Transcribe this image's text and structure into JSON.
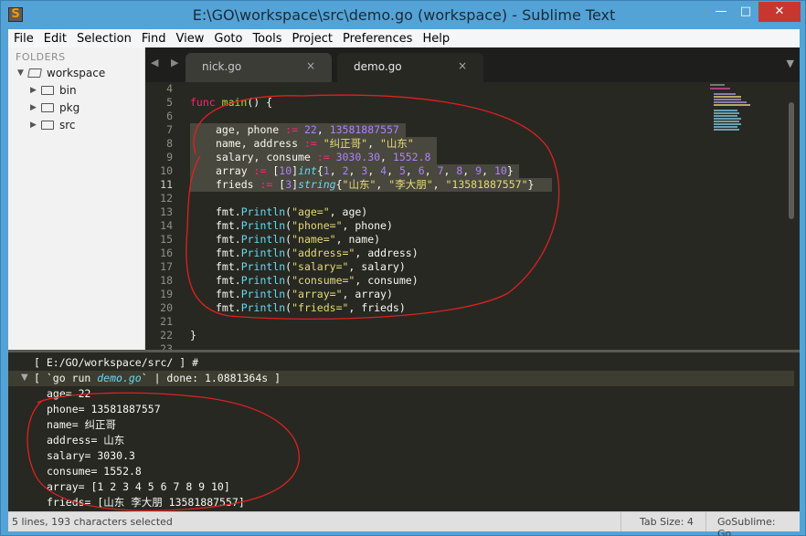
{
  "window": {
    "title": "E:\\GO\\workspace\\src\\demo.go (workspace) - Sublime Text",
    "controls": {
      "minimize": "—",
      "maximize": "□",
      "close": "✕"
    },
    "app_icon": "sublime-logo-icon"
  },
  "menu": [
    "File",
    "Edit",
    "Selection",
    "Find",
    "View",
    "Goto",
    "Tools",
    "Project",
    "Preferences",
    "Help"
  ],
  "sidebar": {
    "header": "FOLDERS",
    "items": [
      {
        "label": "workspace",
        "expanded": true
      },
      {
        "label": "bin",
        "expanded": false
      },
      {
        "label": "pkg",
        "expanded": false
      },
      {
        "label": "src",
        "expanded": false
      }
    ]
  },
  "tabs": [
    {
      "label": "nick.go",
      "active": false,
      "close": "×"
    },
    {
      "label": "demo.go",
      "active": true,
      "close": "×"
    }
  ],
  "tab_nav": "◀ ▶",
  "tab_dropdown": "▼",
  "editor": {
    "line_numbers": [
      "4",
      "5",
      "6",
      "7",
      "8",
      "9",
      "10",
      "11",
      "12",
      "13",
      "14",
      "15",
      "16",
      "17",
      "18",
      "19",
      "20",
      "21",
      "22",
      "23"
    ],
    "current_line": "11",
    "lines": {
      "l5": {
        "kw": "func",
        "fn": "main",
        "rest": "() {"
      },
      "l7": {
        "a": "age, phone ",
        "op": ":=",
        "b": " ",
        "n1": "22",
        "c": ", ",
        "n2": "13581887557"
      },
      "l8": {
        "a": "name, address ",
        "op": ":=",
        "b": " ",
        "s1": "\"纠正哥\"",
        "c": ", ",
        "s2": "\"山东\""
      },
      "l9": {
        "a": "salary, consume ",
        "op": ":=",
        "b": " ",
        "n1": "3030.30",
        "c": ", ",
        "n2": "1552.8"
      },
      "l10": {
        "a": "array ",
        "op": ":=",
        "b": " [",
        "n0": "10",
        "c": "]",
        "t": "int",
        "d": "{",
        "n1": "1",
        "n2": "2",
        "n3": "3",
        "n4": "4",
        "n5": "5",
        "n6": "6",
        "n7": "7",
        "n8": "8",
        "n9": "9",
        "n10": "10",
        "e": "}"
      },
      "l11": {
        "a": "frieds ",
        "op": ":=",
        "b": " [",
        "n0": "3",
        "c": "]",
        "t": "string",
        "d": "{",
        "s1": "\"山东\"",
        "s2": "\"李大朋\"",
        "s3": "\"13581887557\"",
        "e": "}"
      },
      "println": [
        {
          "s": "\"age=\"",
          "v": "age"
        },
        {
          "s": "\"phone=\"",
          "v": "phone"
        },
        {
          "s": "\"name=\"",
          "v": "name"
        },
        {
          "s": "\"address=\"",
          "v": "address"
        },
        {
          "s": "\"salary=\"",
          "v": "salary"
        },
        {
          "s": "\"consume=\"",
          "v": "consume"
        },
        {
          "s": "\"array=\"",
          "v": "array"
        },
        {
          "s": "\"frieds=\"",
          "v": "frieds"
        }
      ],
      "pkg": "fmt.",
      "fn": "Println",
      "l22": "}"
    }
  },
  "output": {
    "header": "[ E:/GO/workspace/src/ ] #",
    "cmd_pre": "[ `go run ",
    "cmd_file": "demo.go",
    "cmd_post": "` | done: 1.0881364s ]",
    "lines": [
      "age= 22",
      "phone= 13581887557",
      "name= 纠正哥",
      "address= 山东",
      "salary= 3030.3",
      "consume= 1552.8",
      "array= [1 2 3 4 5 6 7 8 9 10]",
      "frieds= [山东 李大朋 13581887557]"
    ]
  },
  "status": {
    "selection": "5 lines, 193 characters selected",
    "tab_size": "Tab Size: 4",
    "syntax": "GoSublime: Go"
  },
  "colors": {
    "annotation": "#e02020",
    "editor_bg": "#272822",
    "keyword": "#f92672",
    "function": "#a6e22e",
    "string": "#e6db74",
    "number": "#ae81ff"
  }
}
